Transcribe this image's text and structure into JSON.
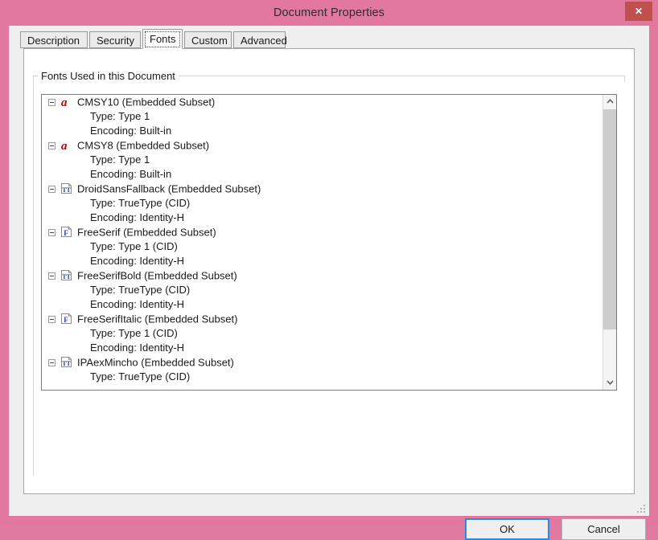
{
  "window": {
    "title": "Document Properties",
    "close_label": "✕"
  },
  "tabs": [
    {
      "label": "Description",
      "active": false
    },
    {
      "label": "Security",
      "active": false
    },
    {
      "label": "Fonts",
      "active": true
    },
    {
      "label": "Custom",
      "active": false
    },
    {
      "label": "Advanced",
      "active": false
    }
  ],
  "fonts_panel": {
    "group_label": "Fonts Used in this Document",
    "entries": [
      {
        "name": "CMSY10 (Embedded Subset)",
        "icon": "type1-font-icon",
        "details": [
          "Type: Type 1",
          "Encoding: Built-in"
        ]
      },
      {
        "name": "CMSY8 (Embedded Subset)",
        "icon": "type1-font-icon",
        "details": [
          "Type: Type 1",
          "Encoding: Built-in"
        ]
      },
      {
        "name": "DroidSansFallback (Embedded Subset)",
        "icon": "truetype-font-icon",
        "details": [
          "Type: TrueType (CID)",
          "Encoding: Identity-H"
        ]
      },
      {
        "name": "FreeSerif (Embedded Subset)",
        "icon": "type1cid-font-icon",
        "details": [
          "Type: Type 1 (CID)",
          "Encoding: Identity-H"
        ]
      },
      {
        "name": "FreeSerifBold (Embedded Subset)",
        "icon": "truetype-font-icon",
        "details": [
          "Type: TrueType (CID)",
          "Encoding: Identity-H"
        ]
      },
      {
        "name": "FreeSerifItalic (Embedded Subset)",
        "icon": "type1cid-font-icon",
        "details": [
          "Type: Type 1 (CID)",
          "Encoding: Identity-H"
        ]
      },
      {
        "name": "IPAexMincho (Embedded Subset)",
        "icon": "truetype-font-icon",
        "details": [
          "Type: TrueType (CID)"
        ]
      }
    ]
  },
  "buttons": {
    "ok": "OK",
    "cancel": "Cancel"
  },
  "colors": {
    "window_frame": "#e3789f",
    "close_button": "#c0504d",
    "client_background": "#efefef",
    "panel_background": "#ffffff",
    "focus_border": "#2a8ce0",
    "type1_icon": "#c00000",
    "truetype_icon": "#1f3fa8",
    "scrollbar_thumb": "#cdcdcd"
  }
}
